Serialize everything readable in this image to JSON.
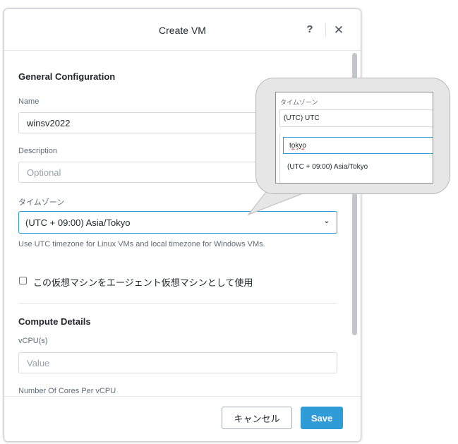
{
  "dialog": {
    "title": "Create VM",
    "help_label": "?",
    "close_label": "✕"
  },
  "general": {
    "section_title": "General Configuration",
    "name_label": "Name",
    "name_value": "winsv2022",
    "description_label": "Description",
    "description_placeholder": "Optional",
    "timezone_label": "タイムゾーン",
    "timezone_value": "(UTC + 09:00) Asia/Tokyo",
    "timezone_hint": "Use UTC timezone for Linux VMs and local timezone for Windows VMs.",
    "agent_vm_label": "この仮想マシンをエージェント仮想マシンとして使用",
    "agent_vm_checked": false
  },
  "compute": {
    "section_title": "Compute Details",
    "vcpu_label": "vCPU(s)",
    "vcpu_placeholder": "Value",
    "cores_label": "Number Of Cores Per vCPU"
  },
  "footer": {
    "cancel_label": "キャンセル",
    "save_label": "Save"
  },
  "callout": {
    "timezone_label": "タイムゾーン",
    "current_value": "(UTC) UTC",
    "search_value": "tokyo",
    "option_label": "(UTC + 09:00) Asia/Tokyo"
  },
  "colors": {
    "accent": "#2f9bd7",
    "callout_bg": "#e6e6e6"
  },
  "icons": {
    "close": "close-icon",
    "help": "help-icon",
    "dropdown": "chevron-down-icon"
  }
}
